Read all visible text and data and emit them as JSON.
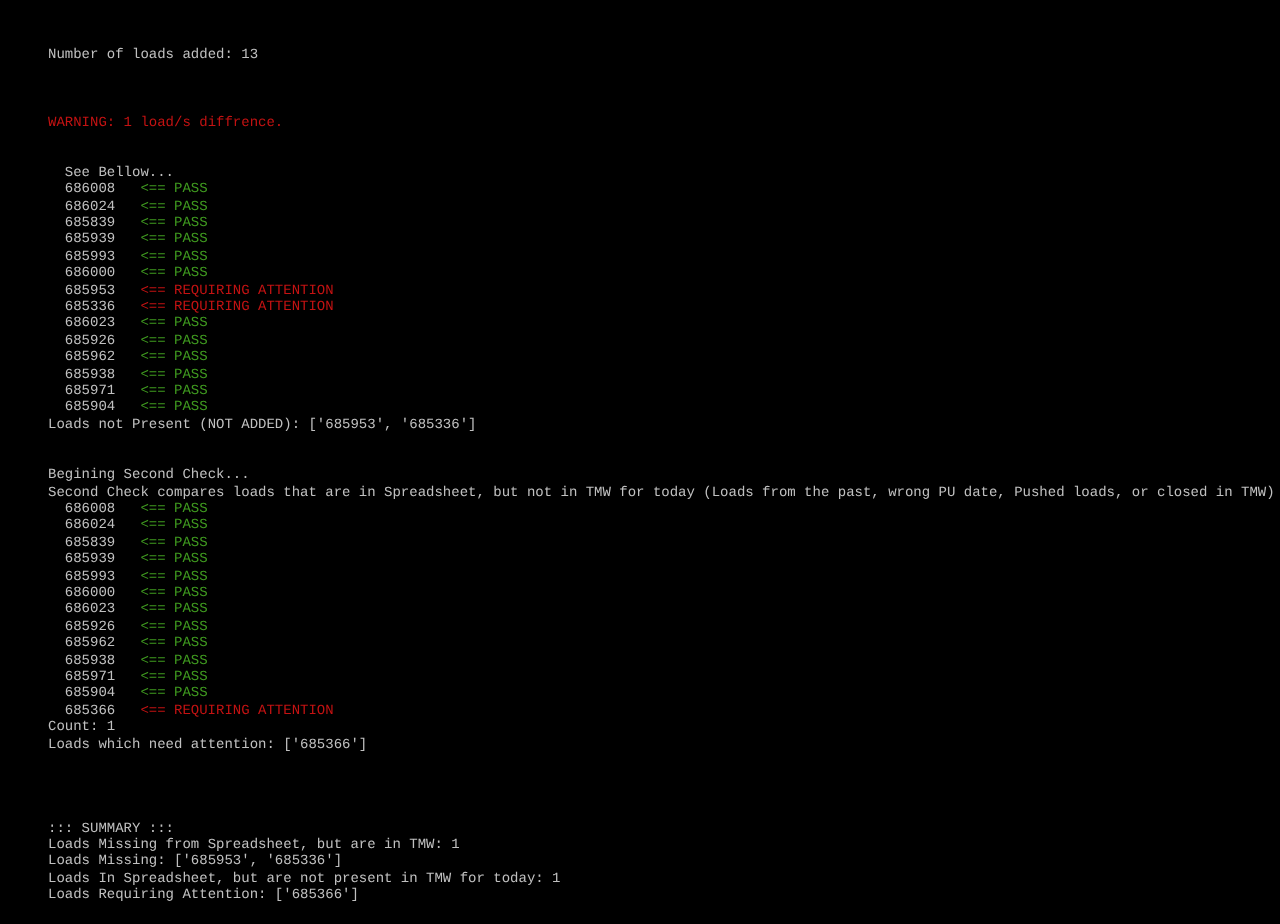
{
  "header": "Number of loads added: 13",
  "warning": "WARNING: 1 load/s diffrence.",
  "first_check": {
    "heading": "See Bellow...",
    "loads": [
      {
        "id": "686008",
        "kind": "pass",
        "marker": "<== PASS"
      },
      {
        "id": "686024",
        "kind": "pass",
        "marker": "<== PASS"
      },
      {
        "id": "685839",
        "kind": "pass",
        "marker": "<== PASS"
      },
      {
        "id": "685939",
        "kind": "pass",
        "marker": "<== PASS"
      },
      {
        "id": "685993",
        "kind": "pass",
        "marker": "<== PASS"
      },
      {
        "id": "686000",
        "kind": "pass",
        "marker": "<== PASS"
      },
      {
        "id": "685953",
        "kind": "attention",
        "marker": "<== REQUIRING ATTENTION"
      },
      {
        "id": "685336",
        "kind": "attention",
        "marker": "<== REQUIRING ATTENTION"
      },
      {
        "id": "686023",
        "kind": "pass",
        "marker": "<== PASS"
      },
      {
        "id": "685926",
        "kind": "pass",
        "marker": "<== PASS"
      },
      {
        "id": "685962",
        "kind": "pass",
        "marker": "<== PASS"
      },
      {
        "id": "685938",
        "kind": "pass",
        "marker": "<== PASS"
      },
      {
        "id": "685971",
        "kind": "pass",
        "marker": "<== PASS"
      },
      {
        "id": "685904",
        "kind": "pass",
        "marker": "<== PASS"
      }
    ],
    "result": "Loads not Present (NOT ADDED): ['685953', '685336']"
  },
  "second_check": {
    "heading": "Begining Second Check...",
    "description": "Second Check compares loads that are in Spreadsheet, but not in TMW for today (Loads from the past, wrong PU date, Pushed loads, or closed in TMW)",
    "loads": [
      {
        "id": "686008",
        "kind": "pass",
        "marker": "<== PASS"
      },
      {
        "id": "686024",
        "kind": "pass",
        "marker": "<== PASS"
      },
      {
        "id": "685839",
        "kind": "pass",
        "marker": "<== PASS"
      },
      {
        "id": "685939",
        "kind": "pass",
        "marker": "<== PASS"
      },
      {
        "id": "685993",
        "kind": "pass",
        "marker": "<== PASS"
      },
      {
        "id": "686000",
        "kind": "pass",
        "marker": "<== PASS"
      },
      {
        "id": "686023",
        "kind": "pass",
        "marker": "<== PASS"
      },
      {
        "id": "685926",
        "kind": "pass",
        "marker": "<== PASS"
      },
      {
        "id": "685962",
        "kind": "pass",
        "marker": "<== PASS"
      },
      {
        "id": "685938",
        "kind": "pass",
        "marker": "<== PASS"
      },
      {
        "id": "685971",
        "kind": "pass",
        "marker": "<== PASS"
      },
      {
        "id": "685904",
        "kind": "pass",
        "marker": "<== PASS"
      },
      {
        "id": "685366",
        "kind": "attention",
        "marker": "<== REQUIRING ATTENTION"
      }
    ],
    "count": "Count: 1",
    "result": "Loads which need attention: ['685366']"
  },
  "summary": {
    "title": "::: SUMMARY :::",
    "lines": [
      "Loads Missing from Spreadsheet, but are in TMW: 1",
      "Loads Missing: ['685953', '685336']",
      "Loads In Spreadsheet, but are not present in TMW for today: 1",
      "Loads Requiring Attention: ['685366']"
    ]
  }
}
